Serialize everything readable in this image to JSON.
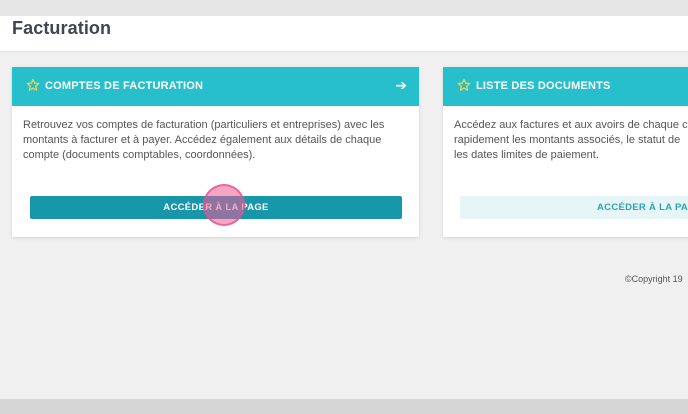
{
  "page": {
    "title": "Facturation"
  },
  "cards": [
    {
      "title": "COMPTES DE FACTURATION",
      "description": "Retrouvez vos comptes de facturation (particuliers et entreprises) avec les montants à facturer et à payer. Accédez également aux détails de chaque compte (documents comptables, coordonnées).",
      "button_label": "ACCÉDER À LA PAGE",
      "arrow_glyph": "➔",
      "icon": "star-icon"
    },
    {
      "title": "LISTE DES DOCUMENTS",
      "description_lines": [
        "Accédez aux factures et aux avoirs de chaque c",
        "rapidement les montants associés, le statut de",
        "les dates limites de paiement."
      ],
      "button_label": "ACCÉDER À LA PAG",
      "icon": "star-icon"
    }
  ],
  "footer": {
    "copyright": "©Copyright 19"
  },
  "colors": {
    "header_teal": "#27bfcc",
    "button_primary": "#1897aa",
    "button_secondary_bg": "#e6f6f8",
    "star_yellow": "#f3d34a",
    "cursor_pink": "#f05a96"
  }
}
